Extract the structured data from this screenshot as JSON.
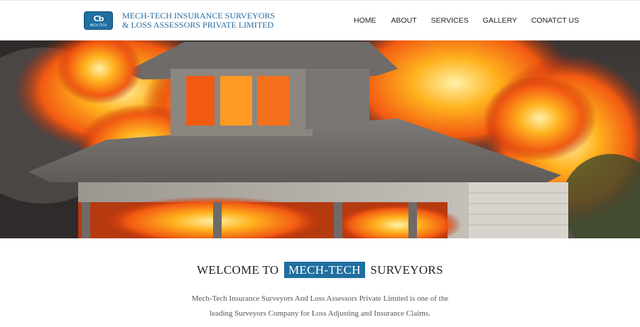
{
  "header": {
    "logo_mark": "Cb",
    "logo_small": "MECH TECH",
    "company_line1": "MECH-TECH INSURANCE SURVEYORS",
    "company_line2": "& LOSS ASSESSORS PRIVATE LIMITED"
  },
  "nav": {
    "home": "HOME",
    "about": "ABOUT",
    "services": "SERVICES",
    "gallery": "GALLERY",
    "contact": "CONATCT US"
  },
  "hero": {
    "image": "burning-house-photo"
  },
  "welcome": {
    "prefix": "WELCOME TO",
    "highlight": "MECH-TECH",
    "suffix": "SURVEYORS"
  },
  "intro": {
    "line1": "Mech-Tech Insurance Surveyors And Loss Assessors Private Limited is one of the",
    "line2": "leading Surveyors Company for Loss Adjusting and Insurance Claims."
  },
  "colors": {
    "brand": "#1f6fa0",
    "company_text": "#2a6da0",
    "fire_orange": "#f25a12",
    "fire_yellow": "#ffb21e"
  }
}
